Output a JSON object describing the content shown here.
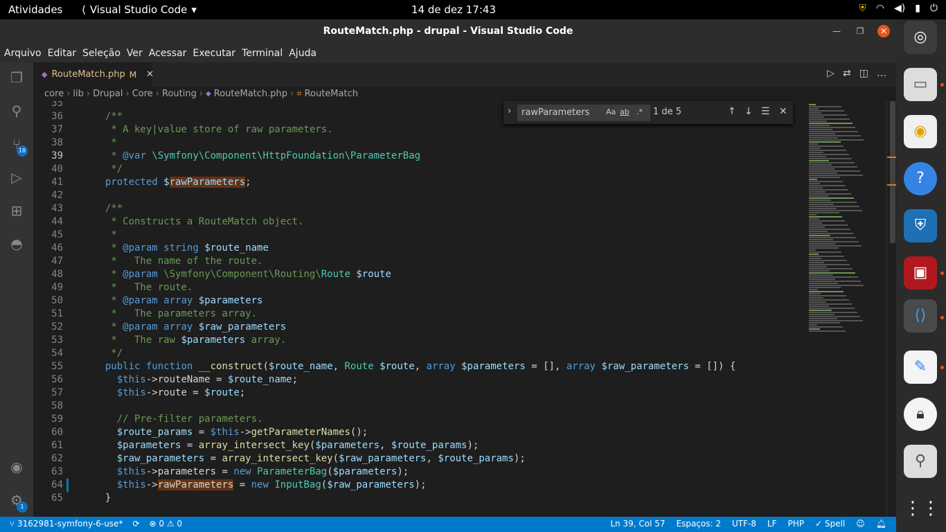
{
  "topbar": {
    "activities": "Atividades",
    "app_name": "Visual Studio Code",
    "clock": "14 de dez  17:43"
  },
  "window": {
    "title": "RouteMatch.php - drupal - Visual Studio Code"
  },
  "menu": [
    "Arquivo",
    "Editar",
    "Seleção",
    "Ver",
    "Acessar",
    "Executar",
    "Terminal",
    "Ajuda"
  ],
  "activitybar": {
    "scm_badge": "18",
    "settings_badge": "1"
  },
  "tab": {
    "filename": "RouteMatch.php",
    "modified": "M"
  },
  "breadcrumb": {
    "parts": [
      "core",
      "lib",
      "Drupal",
      "Core",
      "Routing"
    ],
    "file": "RouteMatch.php",
    "symbol": "RouteMatch"
  },
  "find": {
    "query": "rawParameters",
    "count": "1 de 5",
    "opt_case": "Aa",
    "opt_word": "ab",
    "opt_regex": ".*"
  },
  "lines": [
    {
      "n": "35",
      "t": ""
    },
    {
      "n": "36",
      "t": "  /**"
    },
    {
      "n": "37",
      "t": "   * A key|value store of raw parameters."
    },
    {
      "n": "38",
      "t": "   *"
    },
    {
      "n": "39",
      "t": "   * @var \\Symfony\\Component\\HttpFoundation\\ParameterBag"
    },
    {
      "n": "40",
      "t": "   */"
    },
    {
      "n": "41",
      "t": "  protected $rawParameters;"
    },
    {
      "n": "42",
      "t": ""
    },
    {
      "n": "43",
      "t": "  /**"
    },
    {
      "n": "44",
      "t": "   * Constructs a RouteMatch object."
    },
    {
      "n": "45",
      "t": "   *"
    },
    {
      "n": "46",
      "t": "   * @param string $route_name"
    },
    {
      "n": "47",
      "t": "   *   The name of the route."
    },
    {
      "n": "48",
      "t": "   * @param \\Symfony\\Component\\Routing\\Route $route"
    },
    {
      "n": "49",
      "t": "   *   The route."
    },
    {
      "n": "50",
      "t": "   * @param array $parameters"
    },
    {
      "n": "51",
      "t": "   *   The parameters array."
    },
    {
      "n": "52",
      "t": "   * @param array $raw_parameters"
    },
    {
      "n": "53",
      "t": "   *   The raw $parameters array."
    },
    {
      "n": "54",
      "t": "   */"
    },
    {
      "n": "55",
      "t": "  public function __construct($route_name, Route $route, array $parameters = [], array $raw_parameters = []) {"
    },
    {
      "n": "56",
      "t": "    $this->routeName = $route_name;"
    },
    {
      "n": "57",
      "t": "    $this->route = $route;"
    },
    {
      "n": "58",
      "t": ""
    },
    {
      "n": "59",
      "t": "    // Pre-filter parameters."
    },
    {
      "n": "60",
      "t": "    $route_params = $this->getParameterNames();"
    },
    {
      "n": "61",
      "t": "    $parameters = array_intersect_key($parameters, $route_params);"
    },
    {
      "n": "62",
      "t": "    $raw_parameters = array_intersect_key($raw_parameters, $route_params);"
    },
    {
      "n": "63",
      "t": "    $this->parameters = new ParameterBag($parameters);"
    },
    {
      "n": "64",
      "t": "    $this->rawParameters = new InputBag($raw_parameters);"
    },
    {
      "n": "65",
      "t": "  }"
    }
  ],
  "status": {
    "branch": "3162981-symfony-6-use*",
    "problems": "0",
    "warnings": "0",
    "position": "Ln 39, Col 57",
    "spaces": "Espaços: 2",
    "encoding": "UTF-8",
    "eol": "LF",
    "language": "PHP",
    "spell": "Spell"
  },
  "colors": {
    "status_bg": "#007acc",
    "find_highlight": "#623315",
    "close_button": "#e9541e"
  }
}
